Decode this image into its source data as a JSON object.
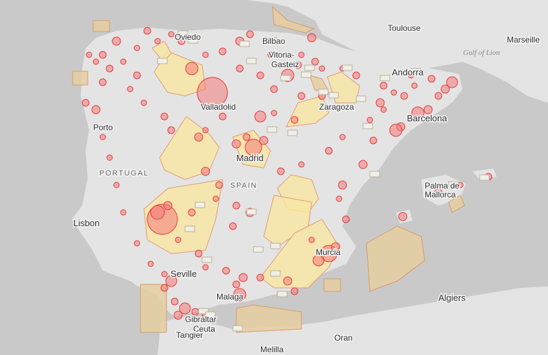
{
  "map": {
    "colors": {
      "sea": "#c9c9c9",
      "land": "#e4e4e4",
      "restricted_zone_fill": "#f7e6a4",
      "restricted_zone_border": "#e39a7a",
      "spot_fill": "#f47a7a",
      "spot_border": "#e63a3a",
      "maritime_zone_fill": "#e6cfa0"
    },
    "labels": {
      "toulouse": "Toulouse",
      "marseille": "Marseille",
      "gulf_of_lion": "Gulf of Lion",
      "oviedo": "Oviedo",
      "bilbao": "Bilbao",
      "vitoria": "Vitoria-",
      "gasteiz": "Gasteiz",
      "andorra": "Andorra",
      "valladolid": "Valladolid",
      "zaragoza": "Zaragoza",
      "porto": "Porto",
      "barcelona": "Barcelona",
      "portugal": "PORTUGAL",
      "madrid": "Madrid",
      "spain": "SPAIN",
      "palma_line1": "Palma de",
      "palma_line2": "Mallorca",
      "lisbon": "Lisbon",
      "murcia": "Murcia",
      "seville": "Seville",
      "algiers": "Algiers",
      "malaga": "Malaga",
      "gibraltar": "Gibraltar",
      "ceuta": "Ceuta",
      "tangier": "Tangier",
      "oran": "Oran",
      "melilla": "Melilla"
    }
  }
}
